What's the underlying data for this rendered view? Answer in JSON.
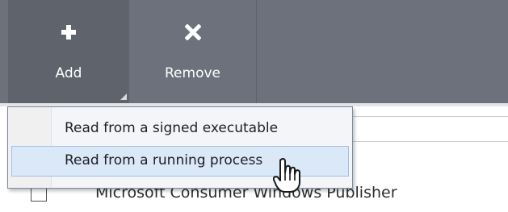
{
  "toolbar": {
    "add": {
      "label": "Add",
      "icon": "plus-icon"
    },
    "remove": {
      "label": "Remove",
      "icon": "x-icon"
    }
  },
  "add_menu": {
    "items": [
      {
        "label": "Read from a signed executable"
      },
      {
        "label": "Read from a running process",
        "highlighted": true
      }
    ]
  },
  "list": {
    "rows": [
      {
        "checked": false,
        "label": "Microsoft Consumer Windows Publisher"
      }
    ]
  },
  "colors": {
    "toolbar_bg": "#6d717b",
    "toolbar_active_bg": "#5e636c",
    "menu_hover_bg": "#dbe8f7",
    "menu_hover_border": "#9fc0e6"
  },
  "cursor": {
    "icon": "hand-pointer-icon"
  }
}
